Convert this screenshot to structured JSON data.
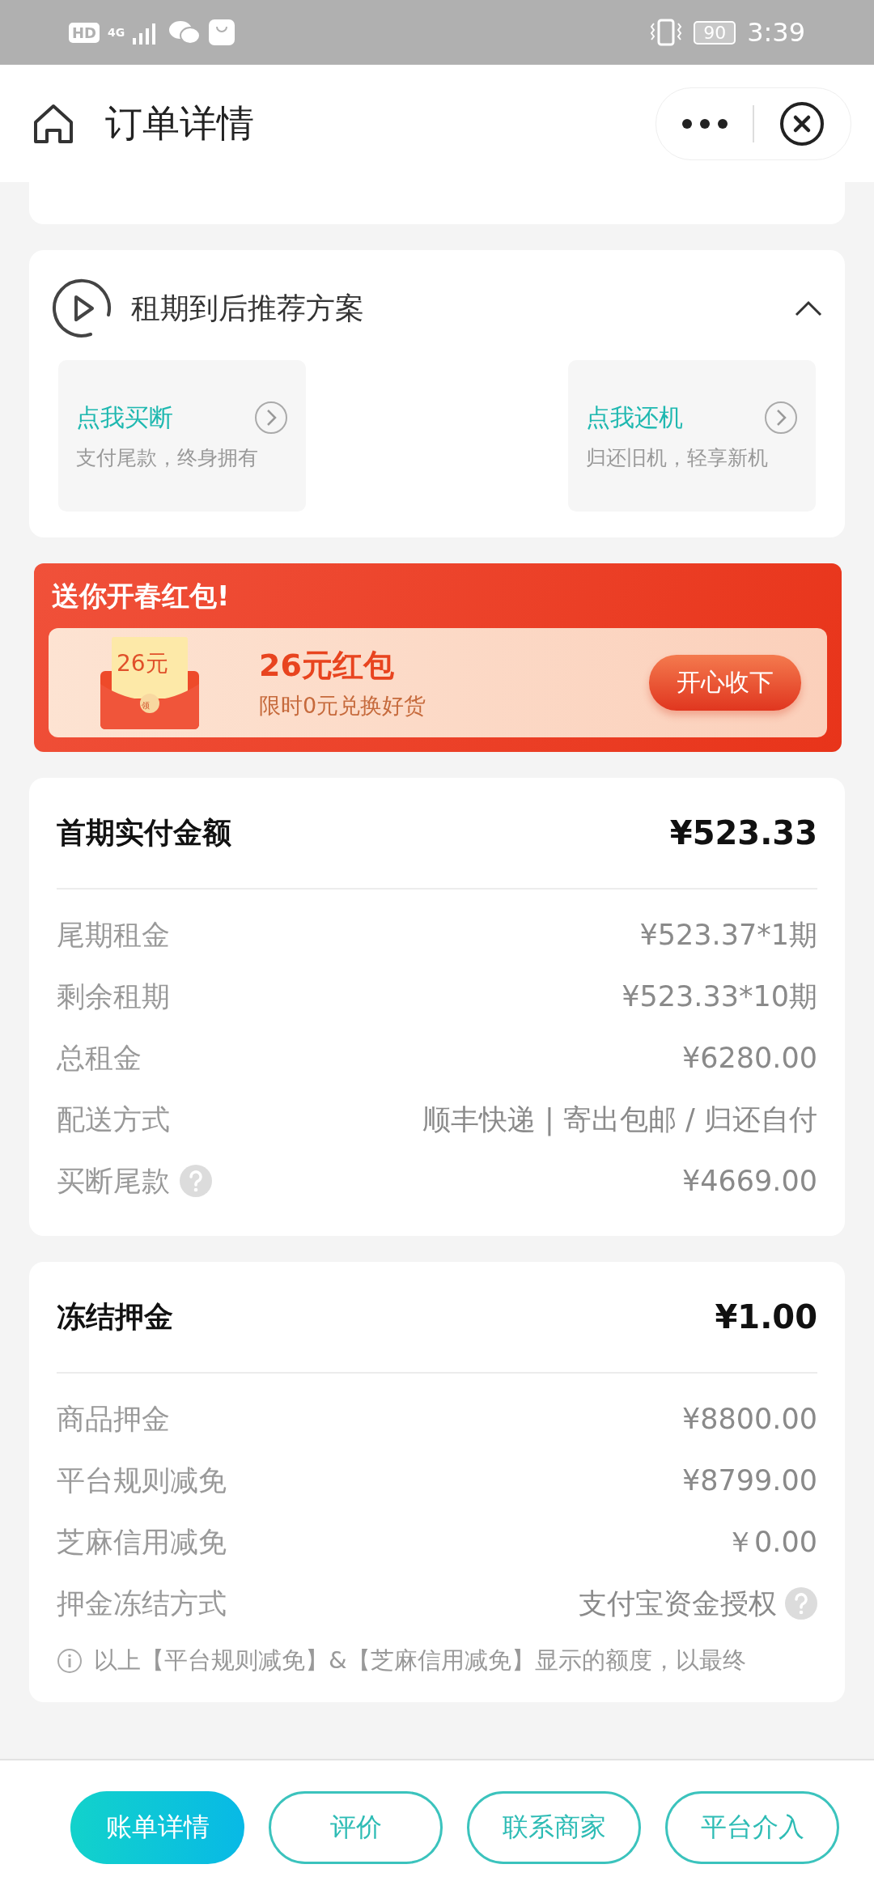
{
  "status_bar": {
    "hd": "HD",
    "network": "4G",
    "battery": "90",
    "time": "3:39"
  },
  "header": {
    "title": "订单详情"
  },
  "plan_card": {
    "title": "租期到后推荐方案",
    "expanded": true,
    "options": [
      {
        "title": "点我买断",
        "subtitle": "支付尾款，终身拥有"
      },
      {
        "title": "点我还机",
        "subtitle": "归还旧机，轻享新机"
      }
    ]
  },
  "promo": {
    "title": "送你开春红包!",
    "envelope_amount": "26元",
    "envelope_seal": "领",
    "headline": "26元红包",
    "subline": "限时0元兑换好货",
    "button": "开心收下"
  },
  "payment": {
    "title": "首期实付金额",
    "amount": "¥523.33",
    "rows": [
      {
        "label": "尾期租金",
        "value": "¥523.37*1期",
        "help": false
      },
      {
        "label": "剩余租期",
        "value": "¥523.33*10期",
        "help": false
      },
      {
        "label": "总租金",
        "value": "¥6280.00",
        "help": false
      },
      {
        "label": "配送方式",
        "value": "顺丰快递 | 寄出包邮 / 归还自付",
        "help": false
      },
      {
        "label": "买断尾款",
        "value": "¥4669.00",
        "help": true
      }
    ]
  },
  "deposit": {
    "title": "冻结押金",
    "amount": "¥1.00",
    "rows": [
      {
        "label": "商品押金",
        "value": "¥8800.00",
        "help": false
      },
      {
        "label": "平台规则减免",
        "value": "¥8799.00",
        "help": false
      },
      {
        "label": "芝麻信用减免",
        "value": "￥0.00",
        "help": false
      },
      {
        "label": "押金冻结方式",
        "value": "支付宝资金授权",
        "help": true
      }
    ],
    "note": "以上【平台规则减免】&【芝麻信用减免】显示的额度，以最终"
  },
  "actions": [
    {
      "label": "账单详情",
      "primary": true
    },
    {
      "label": "评价",
      "primary": false
    },
    {
      "label": "联系商家",
      "primary": false
    },
    {
      "label": "平台介入",
      "primary": false
    }
  ]
}
